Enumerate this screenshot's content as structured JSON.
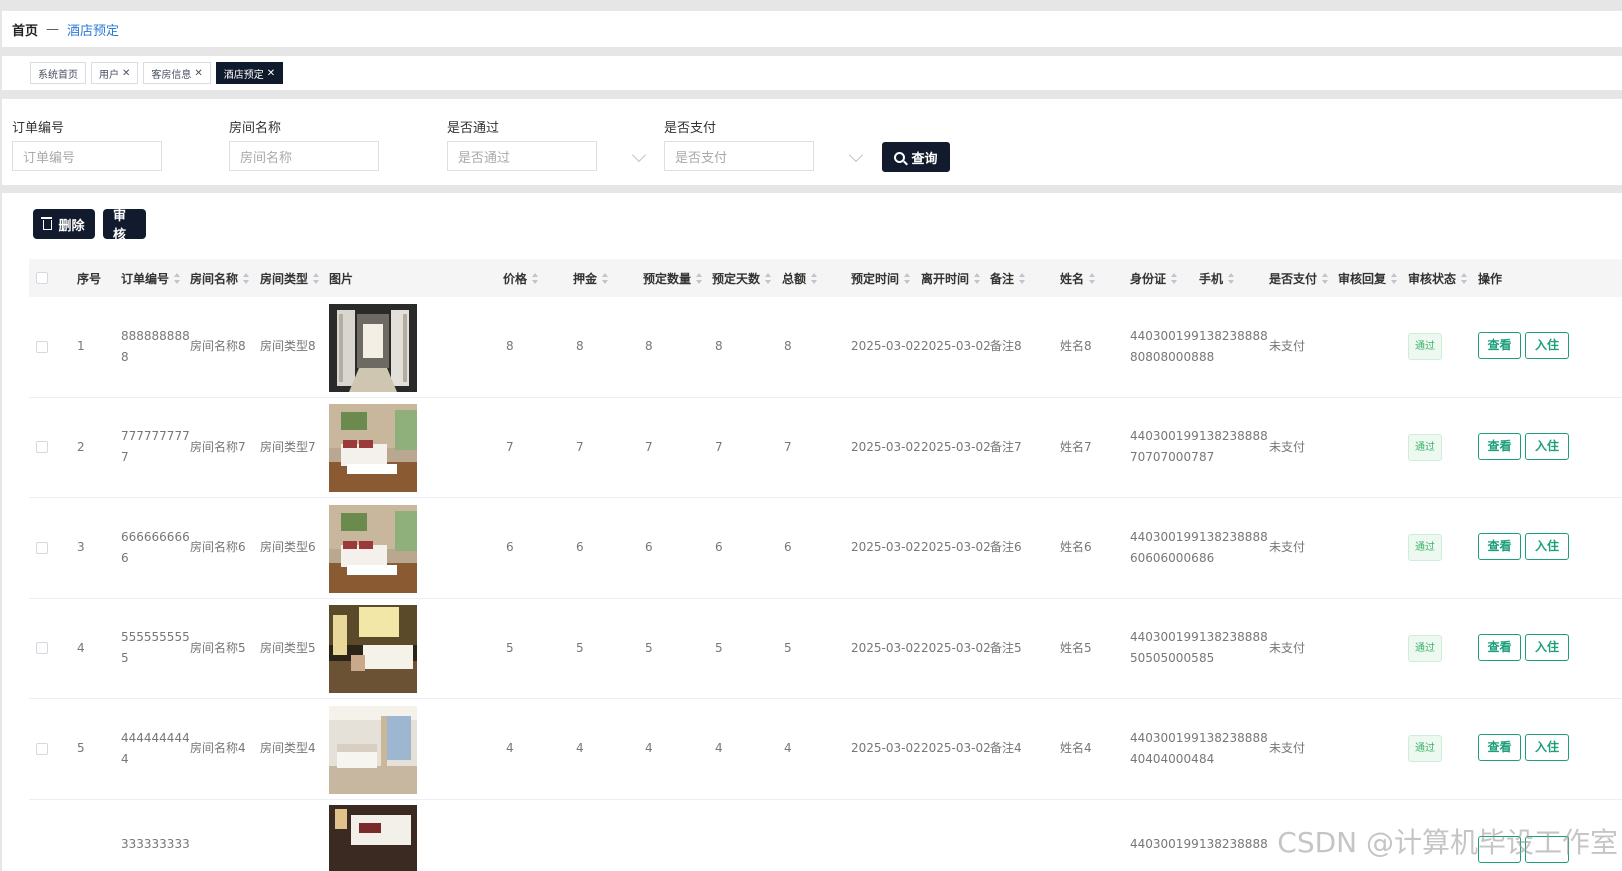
{
  "breadcrumb": {
    "home": "首页",
    "separator": "—",
    "current": "酒店预定"
  },
  "tabs": [
    {
      "label": "系统首页",
      "closable": false,
      "active": false
    },
    {
      "label": "用户",
      "closable": true,
      "active": false
    },
    {
      "label": "客房信息",
      "closable": true,
      "active": false
    },
    {
      "label": "酒店预定",
      "closable": true,
      "active": true
    }
  ],
  "tab_close": "✕",
  "search": {
    "order_no": {
      "label": "订单编号",
      "placeholder": "订单编号"
    },
    "room_name": {
      "label": "房间名称",
      "placeholder": "房间名称"
    },
    "approved": {
      "label": "是否通过",
      "placeholder": "是否通过"
    },
    "paid": {
      "label": "是否支付",
      "placeholder": "是否支付"
    },
    "query_label": "查询"
  },
  "toolbar": {
    "delete_label": "删除",
    "audit_label": "审核"
  },
  "table": {
    "headers": {
      "index": "序号",
      "order_no": "订单编号",
      "room_name": "房间名称",
      "room_type": "房间类型",
      "image": "图片",
      "price": "价格",
      "deposit": "押金",
      "quantity": "预定数量",
      "days": "预定天数",
      "total": "总额",
      "book_time": "预定时间",
      "leave_time": "离开时间",
      "note": "备注",
      "name": "姓名",
      "id_card": "身份证",
      "phone": "手机",
      "paid": "是否支付",
      "audit_reply": "审核回复",
      "audit_status": "审核状态",
      "actions": "操作"
    },
    "rows": [
      {
        "index": "1",
        "order_no_1": "888888888",
        "order_no_2": "8",
        "room_name": "房间名称8",
        "room_type": "房间类型8",
        "image": "room-entrance",
        "price": "8",
        "deposit": "8",
        "quantity": "8",
        "days": "8",
        "total": "8",
        "book_time": "2025-03-02",
        "leave_time": "2025-03-02",
        "note": "备注8",
        "name": "姓名8",
        "id_1": "440300199",
        "id_2": "808080008",
        "phone_1": "138238888",
        "phone_2": "88",
        "paid": "未支付",
        "audit_reply": "",
        "status": "通过",
        "view": "查看",
        "checkin": "入住"
      },
      {
        "index": "2",
        "order_no_1": "777777777",
        "order_no_2": "7",
        "room_name": "房间名称7",
        "room_type": "房间类型7",
        "image": "room-bedroom-wood",
        "price": "7",
        "deposit": "7",
        "quantity": "7",
        "days": "7",
        "total": "7",
        "book_time": "2025-03-02",
        "leave_time": "2025-03-02",
        "note": "备注7",
        "name": "姓名7",
        "id_1": "440300199",
        "id_2": "707070007",
        "phone_1": "138238888",
        "phone_2": "87",
        "paid": "未支付",
        "audit_reply": "",
        "status": "通过",
        "view": "查看",
        "checkin": "入住"
      },
      {
        "index": "3",
        "order_no_1": "666666666",
        "order_no_2": "6",
        "room_name": "房间名称6",
        "room_type": "房间类型6",
        "image": "room-bedroom-wood",
        "price": "6",
        "deposit": "6",
        "quantity": "6",
        "days": "6",
        "total": "6",
        "book_time": "2025-03-02",
        "leave_time": "2025-03-02",
        "note": "备注6",
        "name": "姓名6",
        "id_1": "440300199",
        "id_2": "606060006",
        "phone_1": "138238888",
        "phone_2": "86",
        "paid": "未支付",
        "audit_reply": "",
        "status": "通过",
        "view": "查看",
        "checkin": "入住"
      },
      {
        "index": "4",
        "order_no_1": "555555555",
        "order_no_2": "5",
        "room_name": "房间名称5",
        "room_type": "房间类型5",
        "image": "room-bedroom-warm",
        "price": "5",
        "deposit": "5",
        "quantity": "5",
        "days": "5",
        "total": "5",
        "book_time": "2025-03-02",
        "leave_time": "2025-03-02",
        "note": "备注5",
        "name": "姓名5",
        "id_1": "440300199",
        "id_2": "505050005",
        "phone_1": "138238888",
        "phone_2": "85",
        "paid": "未支付",
        "audit_reply": "",
        "status": "通过",
        "view": "查看",
        "checkin": "入住"
      },
      {
        "index": "5",
        "order_no_1": "444444444",
        "order_no_2": "4",
        "room_name": "房间名称4",
        "room_type": "房间类型4",
        "image": "room-bedroom-light",
        "price": "4",
        "deposit": "4",
        "quantity": "4",
        "days": "4",
        "total": "4",
        "book_time": "2025-03-02",
        "leave_time": "2025-03-02",
        "note": "备注4",
        "name": "姓名4",
        "id_1": "440300199",
        "id_2": "404040004",
        "phone_1": "138238888",
        "phone_2": "84",
        "paid": "未支付",
        "audit_reply": "",
        "status": "通过",
        "view": "查看",
        "checkin": "入住"
      },
      {
        "index": "",
        "order_no_1": "333333333",
        "order_no_2": "",
        "room_name": "",
        "room_type": "",
        "image": "room-bedroom-dark",
        "price": "",
        "deposit": "",
        "quantity": "",
        "days": "",
        "total": "",
        "book_time": "",
        "leave_time": "",
        "note": "",
        "name": "",
        "id_1": "440300199",
        "id_2": "",
        "phone_1": "138238888",
        "phone_2": "",
        "paid": "",
        "audit_reply": "",
        "status": "",
        "view": "",
        "checkin": ""
      }
    ]
  },
  "watermark": "CSDN @计算机毕设工作室",
  "colors": {
    "dark_button": "#111b2d",
    "link_blue": "#2b7ad6",
    "action_green": "#1c9f7a",
    "status_green": "#3fb36a"
  }
}
